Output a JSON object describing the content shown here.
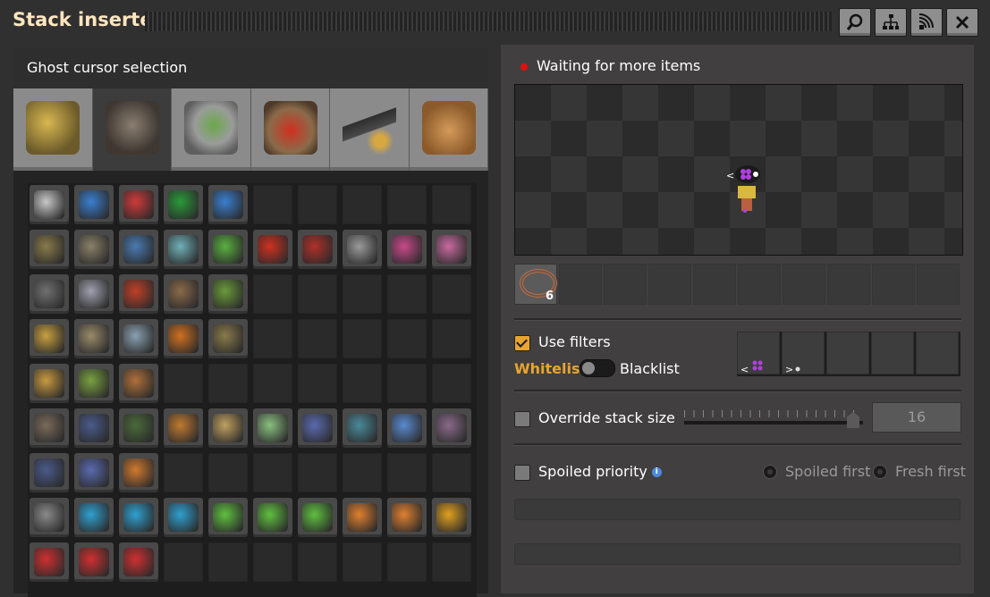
{
  "window": {
    "title": "Stack inserter",
    "buttons": [
      {
        "name": "search",
        "icon": "search-icon"
      },
      {
        "name": "network",
        "icon": "network-tree-icon"
      },
      {
        "name": "circuit",
        "icon": "circuit-wireless-icon"
      },
      {
        "name": "close",
        "icon": "close-icon"
      }
    ]
  },
  "ghost_selection": {
    "header": "Ghost cursor selection",
    "selected_tab_index": 1,
    "tabs": [
      {
        "icon": "logistics-group-icon",
        "color": "#c9a640"
      },
      {
        "icon": "production-group-icon",
        "color": "#6a5f54"
      },
      {
        "icon": "intermediate-products-group-icon",
        "color": "#a8aca8"
      },
      {
        "icon": "space-age-group-icon",
        "color": "#b0522e"
      },
      {
        "icon": "combat-group-icon",
        "color": "#5a5a5a"
      },
      {
        "icon": "unsorted-group-icon",
        "color": "#c2874a"
      }
    ]
  },
  "status": {
    "text": "Waiting for more items",
    "color": "#e01010"
  },
  "inventory": {
    "hand_count": "6",
    "hand_icon": "copper-cable-icon"
  },
  "filters": {
    "use_filters_label": "Use filters",
    "use_filters_checked": true,
    "whitelist_label": "Whitelist",
    "blacklist_label": "Blacklist",
    "mode": "Whitelist"
  },
  "stack_size": {
    "label": "Override stack size",
    "checked": false,
    "value": "16"
  },
  "spoiled": {
    "label": "Spoiled priority",
    "checked": false,
    "option_1": "Spoiled first",
    "option_2": "Fresh first"
  },
  "colors": {
    "accent": "#e8a430",
    "title": "#ffe6c0",
    "panel": "#413f40"
  }
}
